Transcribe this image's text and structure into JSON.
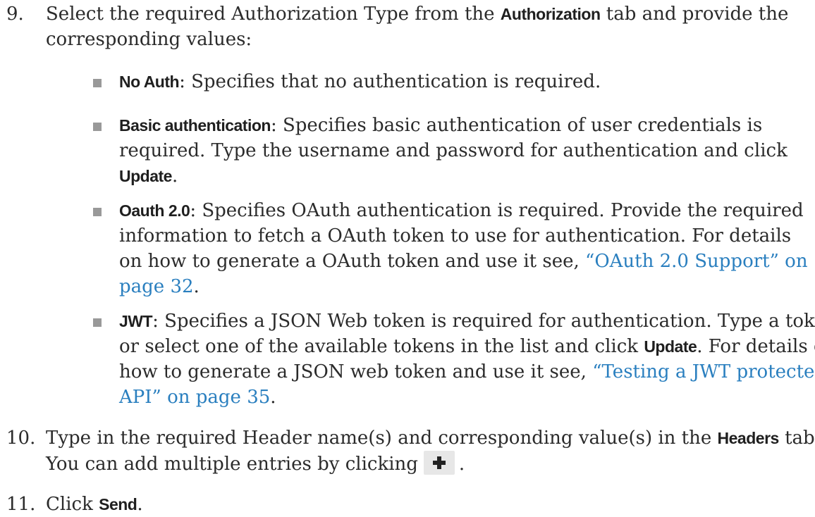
{
  "step9": {
    "number": "9.",
    "text_a": "Select the required Authorization Type from the ",
    "bold_a": "Authorization",
    "text_b": " tab and provide the",
    "line2": "corresponding values:"
  },
  "auth_types": {
    "no_auth": {
      "term": "No Auth",
      "desc": ": Specifies that no authentication is required."
    },
    "basic": {
      "term": "Basic authentication",
      "l1": ": Specifies basic authentication of user credentials is",
      "l2": "required. Type the username and password for authentication and click",
      "l3_bold": "Update",
      "l3_end": "."
    },
    "oauth": {
      "term": "Oauth 2.0",
      "l1": ": Specifies OAuth authentication is required. Provide the required",
      "l2": "information to fetch a OAuth token to use for authentication. For details",
      "l3_text": "on how to generate a OAuth token and use it see, ",
      "l3_link": "“OAuth 2.0 Support” on",
      "l4_link": "page 32",
      "l4_end": "."
    },
    "jwt": {
      "term": "JWT",
      "l1": ": Specifies a JSON Web token is required for authentication. Type a token",
      "l2_a": "or select one of the available tokens in the list and click ",
      "l2_bold": "Update",
      "l2_b": ". For details on",
      "l3_text": "how to generate a JSON web token and use it see, ",
      "l3_link": "“Testing a JWT protected",
      "l4_link": "API” on page 35",
      "l4_end": "."
    }
  },
  "step10": {
    "number": "10.",
    "l1_a": "Type in the required Header name(s) and corresponding value(s) in the ",
    "l1_bold": "Headers",
    "l1_b": " tab.",
    "l2_a": "You can add multiple entries by clicking",
    "l2_b": "."
  },
  "step11": {
    "number": "11.",
    "text_a": "Click ",
    "bold": "Send",
    "text_b": "."
  },
  "icons": {
    "add": "plus-icon"
  },
  "colors": {
    "link": "#2a7fbf",
    "bullet": "#999999",
    "button_bg": "#e7e7e7"
  }
}
